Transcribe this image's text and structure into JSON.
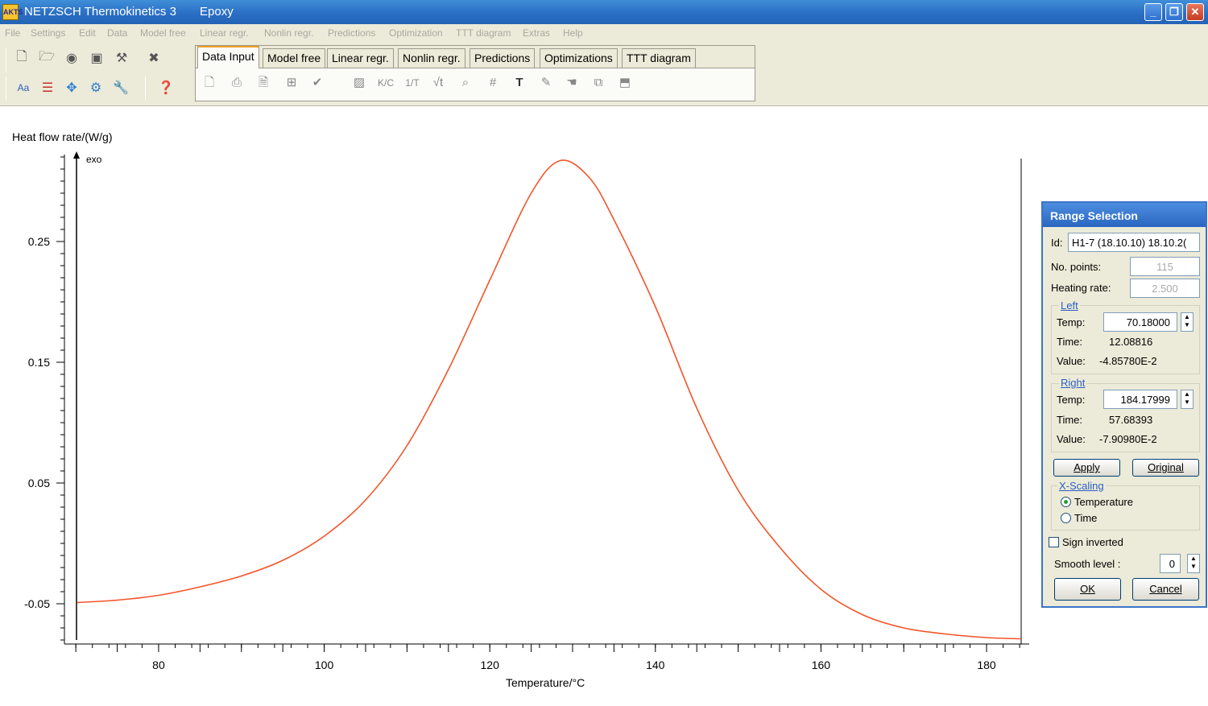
{
  "window": {
    "app_name": "NETZSCH Thermokinetics 3",
    "project": "Epoxy",
    "app_icon": "AKTS",
    "buttons": [
      "minimize-icon",
      "restore-icon",
      "close-icon"
    ]
  },
  "menu": [
    "File",
    "Settings",
    "Edit",
    "Data",
    "Model free",
    "Linear regr.",
    "Nonlin regr.",
    "Predictions",
    "Optimization",
    "TTT diagram",
    "Extras",
    "Help"
  ],
  "tabs": [
    "Data Input",
    "Model free",
    "Linear regr.",
    "Nonlin regr.",
    "Predictions",
    "Optimizations",
    "TTT diagram"
  ],
  "active_tab": "Data Input",
  "plot": {
    "ylabel": "Heat flow rate/(W/g)",
    "xlabel": "Temperature/°C",
    "exo_label": "exo",
    "line_color": "#f2552a"
  },
  "chart_data": {
    "type": "line",
    "xlabel": "Temperature/°C",
    "ylabel": "Heat flow rate/(W/g)",
    "xlim": [
      70.18,
      184.18
    ],
    "ylim": [
      -0.08,
      0.32
    ],
    "x_ticks": [
      80,
      100,
      120,
      140,
      160,
      180
    ],
    "y_ticks": [
      -0.05,
      0.05,
      0.15,
      0.25
    ],
    "y_tick_labels": [
      "-0.05",
      "0.05",
      "0.15",
      "0.25"
    ],
    "series": [
      {
        "x": [
          70.18,
          75,
          80,
          85,
          90,
          95,
          100,
          105,
          110,
          115,
          120,
          125,
          128.5,
          132,
          135,
          140,
          145,
          150,
          155,
          160,
          165,
          170,
          175,
          180,
          184.18
        ],
        "y": [
          -0.049,
          -0.047,
          -0.043,
          -0.036,
          -0.027,
          -0.014,
          0.006,
          0.036,
          0.081,
          0.144,
          0.218,
          0.29,
          0.317,
          0.303,
          0.268,
          0.196,
          0.112,
          0.044,
          -0.003,
          -0.038,
          -0.059,
          -0.07,
          -0.075,
          -0.078,
          -0.079
        ]
      }
    ]
  },
  "dialog": {
    "title": "Range Selection",
    "id_label": "Id:",
    "id_value": "H1-7 (18.10.10) 18.10.2(",
    "points_label": "No. points:",
    "points_value": "115",
    "rate_label": "Heating rate:",
    "rate_value": "2.500",
    "left": {
      "group": "Left",
      "temp_label": "Temp:",
      "temp_value": "70.18000",
      "time_label": "Time:",
      "time_value": "12.08816",
      "value_label": "Value:",
      "value_value": "-4.85780E-2"
    },
    "right": {
      "group": "Right",
      "temp_label": "Temp:",
      "temp_value": "184.17999",
      "time_label": "Time:",
      "time_value": "57.68393",
      "value_label": "Value:",
      "value_value": "-7.90980E-2"
    },
    "apply": "Apply",
    "original": "Original",
    "xscaling": {
      "group": "X-Scaling",
      "temperature": "Temperature",
      "time": "Time",
      "selected": "Temperature"
    },
    "sign_inverted": "Sign inverted",
    "smooth_label": "Smooth level :",
    "smooth_value": "0",
    "ok": "OK",
    "cancel": "Cancel"
  }
}
